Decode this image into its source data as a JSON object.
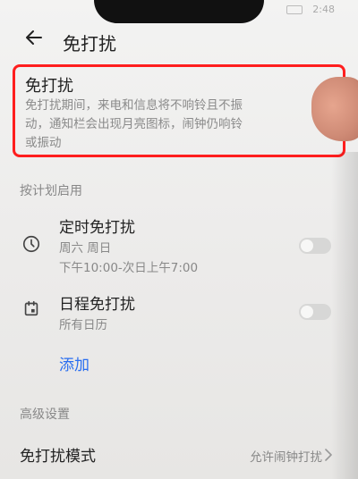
{
  "status_bar": {
    "time": "2:48"
  },
  "header": {
    "title": "免打扰"
  },
  "dnd": {
    "title": "免打扰",
    "description_lines": [
      "免打扰期间，来电和信息将不响铃且不振",
      "动，通知栏会出现月亮图标，闹钟仍响铃",
      "或振动"
    ]
  },
  "schedule": {
    "section_label": "按计划启用",
    "timed": {
      "title": "定时免打扰",
      "days": "周六 周日",
      "time_range": "下午10:00-次日上午7:00",
      "enabled": false
    },
    "calendar": {
      "title": "日程免打扰",
      "subtitle": "所有日历",
      "enabled": false
    },
    "add_label": "添加"
  },
  "advanced": {
    "section_label": "高级设置",
    "mode": {
      "label": "免打扰模式",
      "value": "允许闹钟打扰"
    }
  },
  "colors": {
    "highlight": "#ff1e1e",
    "link": "#2a6ef0"
  },
  "icons": [
    "back-arrow-icon",
    "clock-icon",
    "calendar-icon",
    "chevron-right-icon"
  ]
}
